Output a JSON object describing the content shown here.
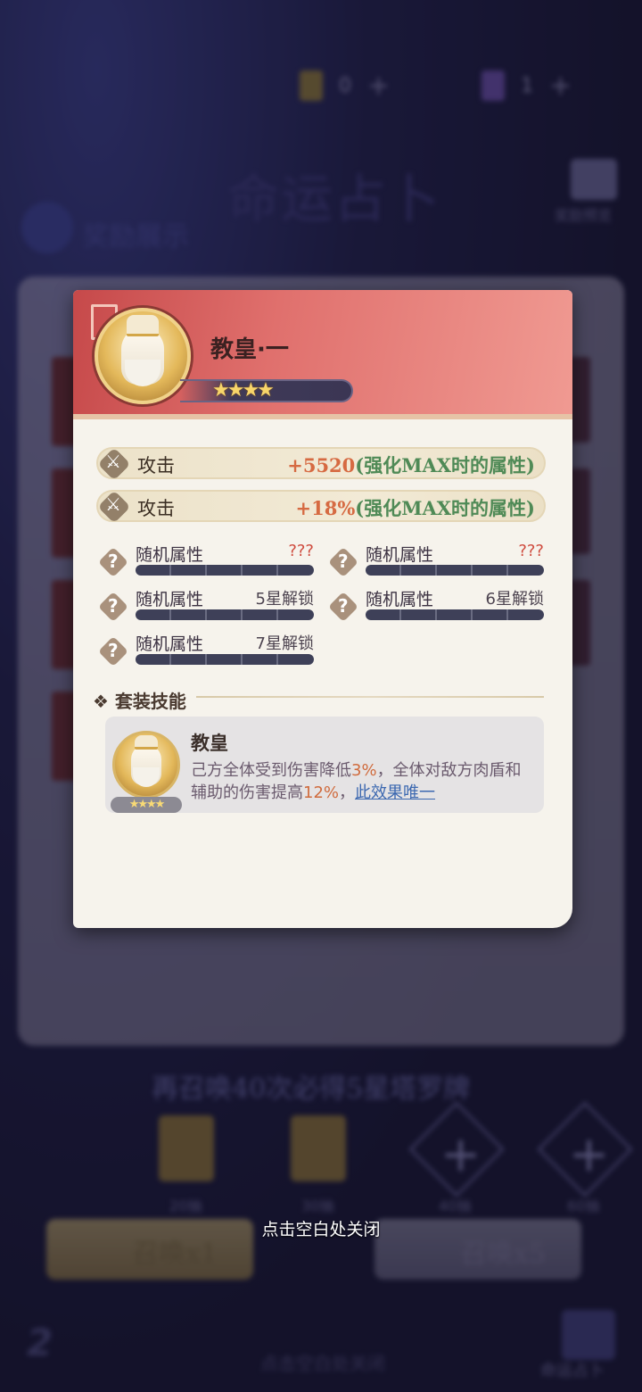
{
  "background": {
    "resource_counts": [
      "0",
      "1"
    ],
    "title": "命运占卜",
    "reward_label": "奖励展示",
    "gift_label": "奖励预览",
    "banner": "再召唤40次必得5星塔罗牌",
    "slot_labels": [
      "20抽",
      "30抽",
      "40抽",
      "60抽"
    ],
    "summon_x1": "召唤x1",
    "summon_x5": "召唤x5",
    "footer_hint": "点击空白处关闭",
    "book_label": "命运占卜"
  },
  "card": {
    "name": "教皇·一",
    "stars": "★★★★",
    "main_stats": [
      {
        "name": "攻击",
        "value": "+5520",
        "suffix": "(强化MAX时的属性)"
      },
      {
        "name": "攻击",
        "value": "+18%",
        "suffix": "(强化MAX时的属性)"
      }
    ],
    "random_attrs": [
      {
        "label": "随机属性",
        "value": "???"
      },
      {
        "label": "随机属性",
        "value": "???"
      },
      {
        "label": "随机属性",
        "value": "5星解锁"
      },
      {
        "label": "随机属性",
        "value": "6星解锁"
      },
      {
        "label": "随机属性",
        "value": "7星解锁"
      }
    ],
    "set_skill": {
      "section_title": "套装技能",
      "name": "教皇",
      "stars": "★★★★",
      "desc_a": "己方全体受到伤害降低",
      "desc_b": "3%",
      "desc_c": "，全体对敌方肉盾和辅助的伤害提高",
      "desc_d": "12%",
      "desc_e": "，",
      "desc_link": "此效果唯一"
    }
  },
  "close_hint": "点击空白处关闭",
  "colors": {
    "header_red": "#c6494a",
    "value_orange": "#d66a42",
    "value_green": "#4f8a56",
    "link_blue": "#3c68b0"
  }
}
